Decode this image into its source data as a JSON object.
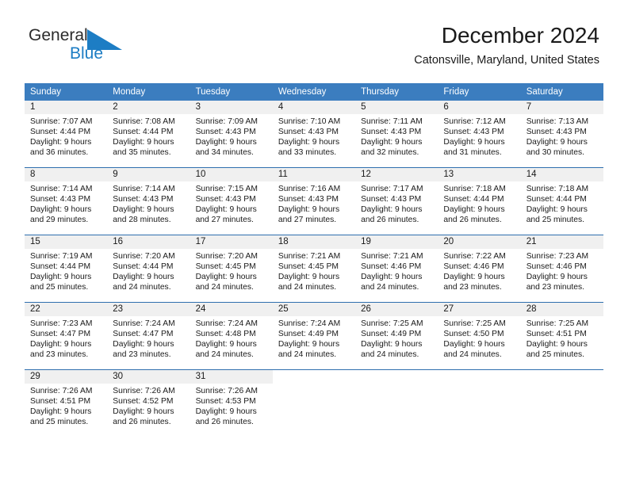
{
  "brand": {
    "name_part1": "General",
    "name_part2": "Blue",
    "triangle_color": "#1d7dc4"
  },
  "header": {
    "title": "December 2024",
    "subtitle": "Catonsville, Maryland, United States"
  },
  "theme": {
    "header_bar_color": "#3b7dbf",
    "row_divider_color": "#2f6fae",
    "date_band_color": "#f0f0f0",
    "text_color": "#1a1a1a"
  },
  "weekday_headers": [
    "Sunday",
    "Monday",
    "Tuesday",
    "Wednesday",
    "Thursday",
    "Friday",
    "Saturday"
  ],
  "weeks": [
    [
      {
        "day": "1",
        "sunrise": "Sunrise: 7:07 AM",
        "sunset": "Sunset: 4:44 PM",
        "daylight_line1": "Daylight: 9 hours",
        "daylight_line2": "and 36 minutes."
      },
      {
        "day": "2",
        "sunrise": "Sunrise: 7:08 AM",
        "sunset": "Sunset: 4:44 PM",
        "daylight_line1": "Daylight: 9 hours",
        "daylight_line2": "and 35 minutes."
      },
      {
        "day": "3",
        "sunrise": "Sunrise: 7:09 AM",
        "sunset": "Sunset: 4:43 PM",
        "daylight_line1": "Daylight: 9 hours",
        "daylight_line2": "and 34 minutes."
      },
      {
        "day": "4",
        "sunrise": "Sunrise: 7:10 AM",
        "sunset": "Sunset: 4:43 PM",
        "daylight_line1": "Daylight: 9 hours",
        "daylight_line2": "and 33 minutes."
      },
      {
        "day": "5",
        "sunrise": "Sunrise: 7:11 AM",
        "sunset": "Sunset: 4:43 PM",
        "daylight_line1": "Daylight: 9 hours",
        "daylight_line2": "and 32 minutes."
      },
      {
        "day": "6",
        "sunrise": "Sunrise: 7:12 AM",
        "sunset": "Sunset: 4:43 PM",
        "daylight_line1": "Daylight: 9 hours",
        "daylight_line2": "and 31 minutes."
      },
      {
        "day": "7",
        "sunrise": "Sunrise: 7:13 AM",
        "sunset": "Sunset: 4:43 PM",
        "daylight_line1": "Daylight: 9 hours",
        "daylight_line2": "and 30 minutes."
      }
    ],
    [
      {
        "day": "8",
        "sunrise": "Sunrise: 7:14 AM",
        "sunset": "Sunset: 4:43 PM",
        "daylight_line1": "Daylight: 9 hours",
        "daylight_line2": "and 29 minutes."
      },
      {
        "day": "9",
        "sunrise": "Sunrise: 7:14 AM",
        "sunset": "Sunset: 4:43 PM",
        "daylight_line1": "Daylight: 9 hours",
        "daylight_line2": "and 28 minutes."
      },
      {
        "day": "10",
        "sunrise": "Sunrise: 7:15 AM",
        "sunset": "Sunset: 4:43 PM",
        "daylight_line1": "Daylight: 9 hours",
        "daylight_line2": "and 27 minutes."
      },
      {
        "day": "11",
        "sunrise": "Sunrise: 7:16 AM",
        "sunset": "Sunset: 4:43 PM",
        "daylight_line1": "Daylight: 9 hours",
        "daylight_line2": "and 27 minutes."
      },
      {
        "day": "12",
        "sunrise": "Sunrise: 7:17 AM",
        "sunset": "Sunset: 4:43 PM",
        "daylight_line1": "Daylight: 9 hours",
        "daylight_line2": "and 26 minutes."
      },
      {
        "day": "13",
        "sunrise": "Sunrise: 7:18 AM",
        "sunset": "Sunset: 4:44 PM",
        "daylight_line1": "Daylight: 9 hours",
        "daylight_line2": "and 26 minutes."
      },
      {
        "day": "14",
        "sunrise": "Sunrise: 7:18 AM",
        "sunset": "Sunset: 4:44 PM",
        "daylight_line1": "Daylight: 9 hours",
        "daylight_line2": "and 25 minutes."
      }
    ],
    [
      {
        "day": "15",
        "sunrise": "Sunrise: 7:19 AM",
        "sunset": "Sunset: 4:44 PM",
        "daylight_line1": "Daylight: 9 hours",
        "daylight_line2": "and 25 minutes."
      },
      {
        "day": "16",
        "sunrise": "Sunrise: 7:20 AM",
        "sunset": "Sunset: 4:44 PM",
        "daylight_line1": "Daylight: 9 hours",
        "daylight_line2": "and 24 minutes."
      },
      {
        "day": "17",
        "sunrise": "Sunrise: 7:20 AM",
        "sunset": "Sunset: 4:45 PM",
        "daylight_line1": "Daylight: 9 hours",
        "daylight_line2": "and 24 minutes."
      },
      {
        "day": "18",
        "sunrise": "Sunrise: 7:21 AM",
        "sunset": "Sunset: 4:45 PM",
        "daylight_line1": "Daylight: 9 hours",
        "daylight_line2": "and 24 minutes."
      },
      {
        "day": "19",
        "sunrise": "Sunrise: 7:21 AM",
        "sunset": "Sunset: 4:46 PM",
        "daylight_line1": "Daylight: 9 hours",
        "daylight_line2": "and 24 minutes."
      },
      {
        "day": "20",
        "sunrise": "Sunrise: 7:22 AM",
        "sunset": "Sunset: 4:46 PM",
        "daylight_line1": "Daylight: 9 hours",
        "daylight_line2": "and 23 minutes."
      },
      {
        "day": "21",
        "sunrise": "Sunrise: 7:23 AM",
        "sunset": "Sunset: 4:46 PM",
        "daylight_line1": "Daylight: 9 hours",
        "daylight_line2": "and 23 minutes."
      }
    ],
    [
      {
        "day": "22",
        "sunrise": "Sunrise: 7:23 AM",
        "sunset": "Sunset: 4:47 PM",
        "daylight_line1": "Daylight: 9 hours",
        "daylight_line2": "and 23 minutes."
      },
      {
        "day": "23",
        "sunrise": "Sunrise: 7:24 AM",
        "sunset": "Sunset: 4:47 PM",
        "daylight_line1": "Daylight: 9 hours",
        "daylight_line2": "and 23 minutes."
      },
      {
        "day": "24",
        "sunrise": "Sunrise: 7:24 AM",
        "sunset": "Sunset: 4:48 PM",
        "daylight_line1": "Daylight: 9 hours",
        "daylight_line2": "and 24 minutes."
      },
      {
        "day": "25",
        "sunrise": "Sunrise: 7:24 AM",
        "sunset": "Sunset: 4:49 PM",
        "daylight_line1": "Daylight: 9 hours",
        "daylight_line2": "and 24 minutes."
      },
      {
        "day": "26",
        "sunrise": "Sunrise: 7:25 AM",
        "sunset": "Sunset: 4:49 PM",
        "daylight_line1": "Daylight: 9 hours",
        "daylight_line2": "and 24 minutes."
      },
      {
        "day": "27",
        "sunrise": "Sunrise: 7:25 AM",
        "sunset": "Sunset: 4:50 PM",
        "daylight_line1": "Daylight: 9 hours",
        "daylight_line2": "and 24 minutes."
      },
      {
        "day": "28",
        "sunrise": "Sunrise: 7:25 AM",
        "sunset": "Sunset: 4:51 PM",
        "daylight_line1": "Daylight: 9 hours",
        "daylight_line2": "and 25 minutes."
      }
    ],
    [
      {
        "day": "29",
        "sunrise": "Sunrise: 7:26 AM",
        "sunset": "Sunset: 4:51 PM",
        "daylight_line1": "Daylight: 9 hours",
        "daylight_line2": "and 25 minutes."
      },
      {
        "day": "30",
        "sunrise": "Sunrise: 7:26 AM",
        "sunset": "Sunset: 4:52 PM",
        "daylight_line1": "Daylight: 9 hours",
        "daylight_line2": "and 26 minutes."
      },
      {
        "day": "31",
        "sunrise": "Sunrise: 7:26 AM",
        "sunset": "Sunset: 4:53 PM",
        "daylight_line1": "Daylight: 9 hours",
        "daylight_line2": "and 26 minutes."
      },
      {
        "day": "",
        "sunrise": "",
        "sunset": "",
        "daylight_line1": "",
        "daylight_line2": ""
      },
      {
        "day": "",
        "sunrise": "",
        "sunset": "",
        "daylight_line1": "",
        "daylight_line2": ""
      },
      {
        "day": "",
        "sunrise": "",
        "sunset": "",
        "daylight_line1": "",
        "daylight_line2": ""
      },
      {
        "day": "",
        "sunrise": "",
        "sunset": "",
        "daylight_line1": "",
        "daylight_line2": ""
      }
    ]
  ]
}
